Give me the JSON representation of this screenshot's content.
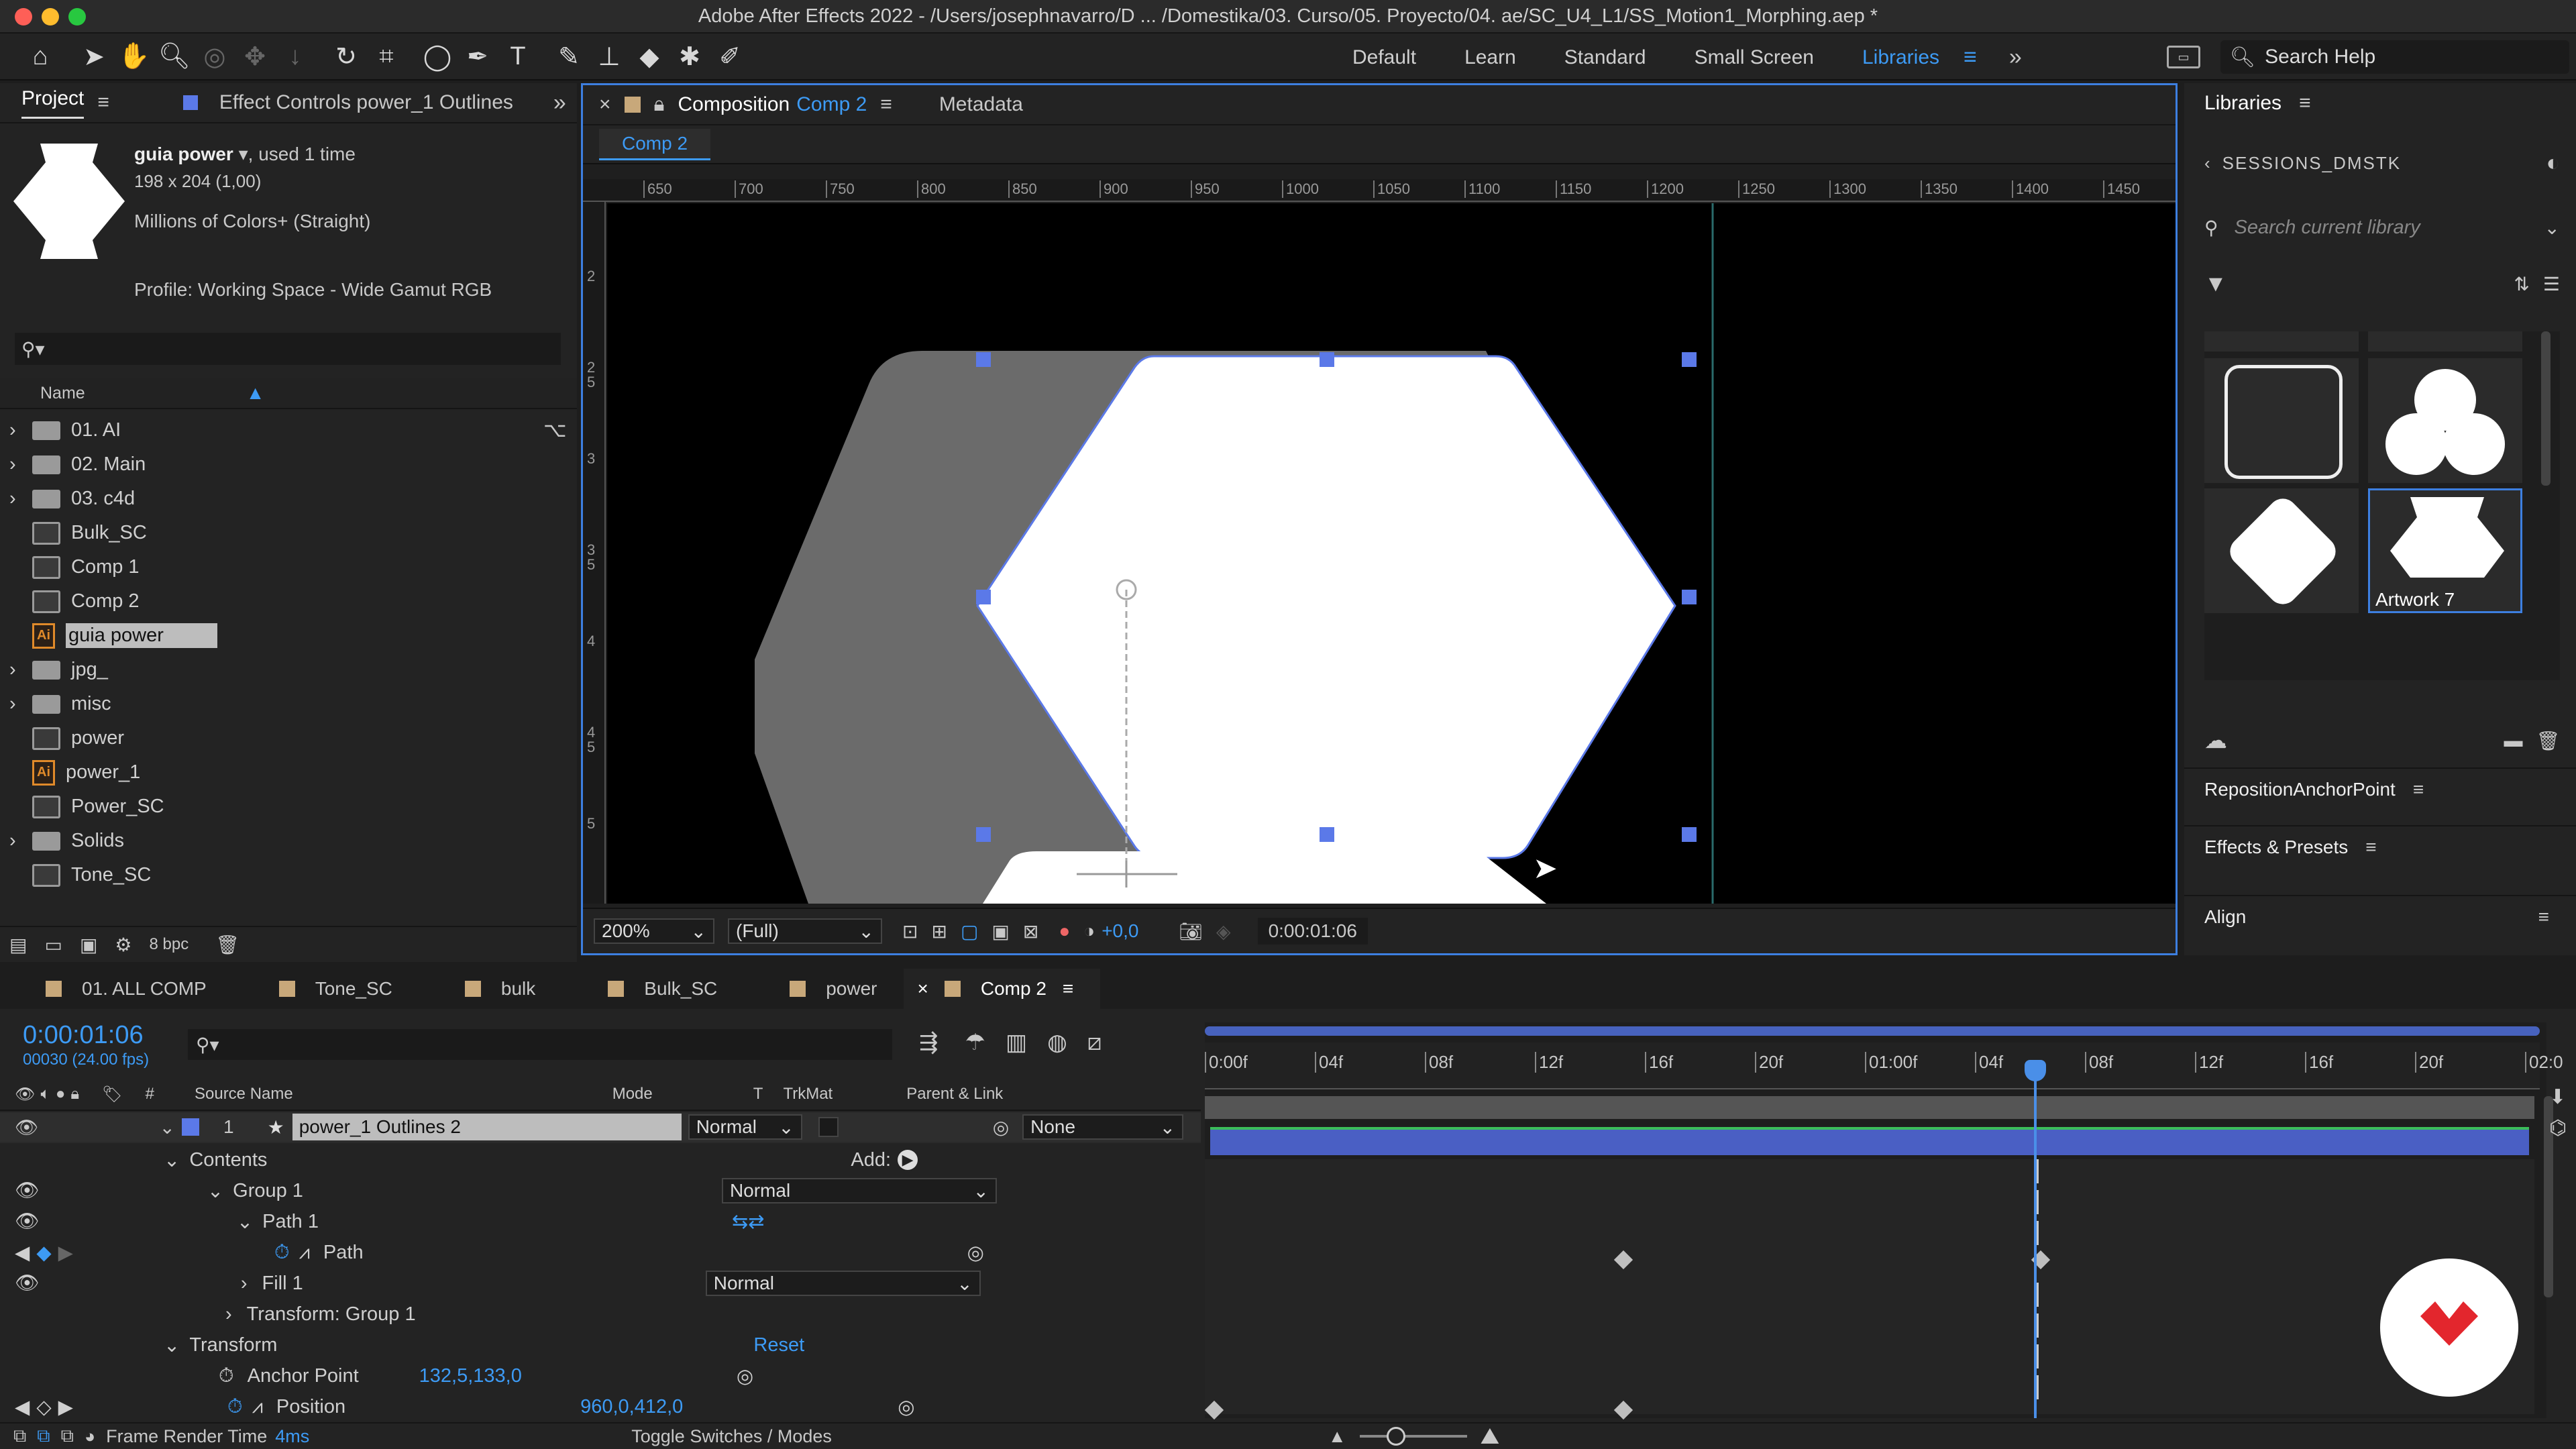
{
  "app_title": "Adobe After Effects 2022 - /Users/josephnavarro/D ... /Domestika/03. Curso/05. Proyecto/04. ae/SC_U4_L1/SS_Motion1_Morphing.aep *",
  "workspaces": [
    "Default",
    "Learn",
    "Standard",
    "Small Screen",
    "Libraries"
  ],
  "search_help": "Search Help",
  "project": {
    "tab": "Project",
    "effect_tab": "Effect Controls power_1 Outlines",
    "asset_name": "guia power",
    "asset_used": ", used 1 time",
    "asset_size": "198 x 204 (1,00)",
    "asset_colors": "Millions of Colors+ (Straight)",
    "profile": "Profile: Working Space - Wide Gamut RGB",
    "name_col": "Name",
    "bpc": "8 bpc",
    "items": [
      {
        "label": "01. AI",
        "type": "folder"
      },
      {
        "label": "02. Main",
        "type": "folder"
      },
      {
        "label": "03. c4d",
        "type": "folder"
      },
      {
        "label": "Bulk_SC",
        "type": "comp"
      },
      {
        "label": "Comp 1",
        "type": "comp"
      },
      {
        "label": "Comp 2",
        "type": "comp"
      },
      {
        "label": "guia power",
        "type": "ai"
      },
      {
        "label": "jpg_",
        "type": "folder"
      },
      {
        "label": "misc",
        "type": "folder"
      },
      {
        "label": "power",
        "type": "comp"
      },
      {
        "label": "power_1",
        "type": "ai"
      },
      {
        "label": "Power_SC",
        "type": "comp"
      },
      {
        "label": "Solids",
        "type": "folder"
      },
      {
        "label": "Tone_SC",
        "type": "comp"
      }
    ]
  },
  "composition": {
    "tab_prefix": "Composition",
    "tab_name": "Comp 2",
    "metadata_tab": "Metadata",
    "breadcrumb": "Comp 2",
    "ruler_ticks": [
      "650",
      "700",
      "750",
      "800",
      "850",
      "900",
      "950",
      "1000",
      "1050",
      "1100",
      "1150",
      "1200",
      "1250",
      "1300",
      "1350",
      "1400",
      "1450"
    ],
    "vruler": [
      "2",
      "2 5",
      "3",
      "3 5",
      "4",
      "4 5",
      "5"
    ],
    "zoom": "200%",
    "resolution": "(Full)",
    "exposure": "+0,0",
    "timecode": "0:00:01:06"
  },
  "libraries": {
    "title": "Libraries",
    "library_name": "SESSIONS_DMSTK",
    "search_placeholder": "Search current library",
    "artwork_label": "Artwork 7",
    "reposition": "RepositionAnchorPoint",
    "effects": "Effects & Presets",
    "align": "Align"
  },
  "timeline": {
    "tabs": [
      "01. ALL COMP",
      "Tone_SC",
      "bulk",
      "Bulk_SC",
      "power",
      "Comp 2"
    ],
    "active_tab": "Comp 2",
    "timecode": "0:00:01:06",
    "frames": "00030 (24.00 fps)",
    "columns": {
      "num": "#",
      "source": "Source Name",
      "mode": "Mode",
      "t": "T",
      "trkmat": "TrkMat",
      "parent": "Parent & Link"
    },
    "ruler": [
      "0:00f",
      "04f",
      "08f",
      "12f",
      "16f",
      "20f",
      "01:00f",
      "04f",
      "08f",
      "12f",
      "16f",
      "20f",
      "02:0"
    ],
    "layer": {
      "num": "1",
      "name": "power_1 Outlines 2",
      "mode": "Normal",
      "parent": "None"
    },
    "props": {
      "contents": "Contents",
      "add": "Add:",
      "group1": "Group 1",
      "group1_mode": "Normal",
      "path1": "Path 1",
      "path": "Path",
      "fill1": "Fill 1",
      "fill1_mode": "Normal",
      "transform_group": "Transform: Group 1",
      "transform": "Transform",
      "reset": "Reset",
      "anchor": "Anchor Point",
      "anchor_val": "132,5,133,0",
      "position": "Position",
      "position_val": "960,0,412,0"
    },
    "footer": {
      "render_label": "Frame Render Time",
      "render_val": "4ms",
      "toggle": "Toggle Switches / Modes"
    }
  },
  "colors": {
    "accent": "#3d9bf5",
    "layer_bar": "#4a5fc4",
    "label_layer": "#5b79e8",
    "watermark": "#e3262d"
  }
}
